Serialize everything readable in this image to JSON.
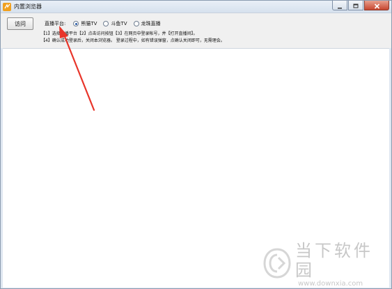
{
  "window": {
    "title": "内置浏览器",
    "controls": [
      "minimize",
      "maximize",
      "close"
    ]
  },
  "toolbar": {
    "visit_label": "访问",
    "platform_label": "直播平台:",
    "platforms": [
      {
        "label": "熊猫TV",
        "checked": true
      },
      {
        "label": "斗鱼TV",
        "checked": false
      },
      {
        "label": "龙珠直播",
        "checked": false
      }
    ],
    "instructions": [
      "【1】选择直播平台【2】点击访问按钮【3】在网页中登录帐号，并【打开直播间】。",
      "【4】确认成功登录后，关闭本浏览器。  登录过程中，如有错误弹窗，点确认关闭即可，无需理会。"
    ]
  },
  "annotation": {
    "arrow_color": "#e8352a"
  },
  "watermark": {
    "brand": "当下软件园",
    "url": "www.downxia.com"
  }
}
